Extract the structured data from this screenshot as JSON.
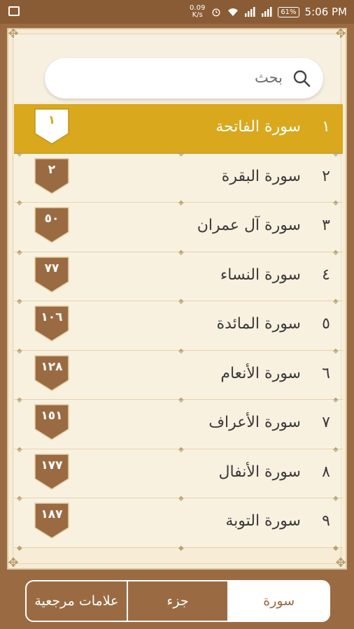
{
  "status_bar": {
    "speed_value": "0.09",
    "speed_unit": "K/s",
    "battery": "61%",
    "time": "5:06 PM"
  },
  "search": {
    "placeholder": "بحث"
  },
  "surahs": [
    {
      "number": "١",
      "name": "سورة الفاتحة",
      "page": "١",
      "active": true
    },
    {
      "number": "٢",
      "name": "سورة البقرة",
      "page": "٢",
      "active": false
    },
    {
      "number": "٣",
      "name": "سورة آل عمران",
      "page": "٥٠",
      "active": false
    },
    {
      "number": "٤",
      "name": "سورة النساء",
      "page": "٧٧",
      "active": false
    },
    {
      "number": "٥",
      "name": "سورة المائدة",
      "page": "١٠٦",
      "active": false
    },
    {
      "number": "٦",
      "name": "سورة الأنعام",
      "page": "١٢٨",
      "active": false
    },
    {
      "number": "٧",
      "name": "سورة الأعراف",
      "page": "١٥١",
      "active": false
    },
    {
      "number": "٨",
      "name": "سورة الأنفال",
      "page": "١٧٧",
      "active": false
    },
    {
      "number": "٩",
      "name": "سورة التوبة",
      "page": "١٨٧",
      "active": false
    }
  ],
  "tabs": [
    {
      "label": "علامات مرجعية",
      "selected": false
    },
    {
      "label": "جزء",
      "selected": false
    },
    {
      "label": "سورة",
      "selected": true
    }
  ],
  "colors": {
    "accent": "#d9a81c",
    "brown": "#9a6b42",
    "background": "#f7ecd6"
  }
}
